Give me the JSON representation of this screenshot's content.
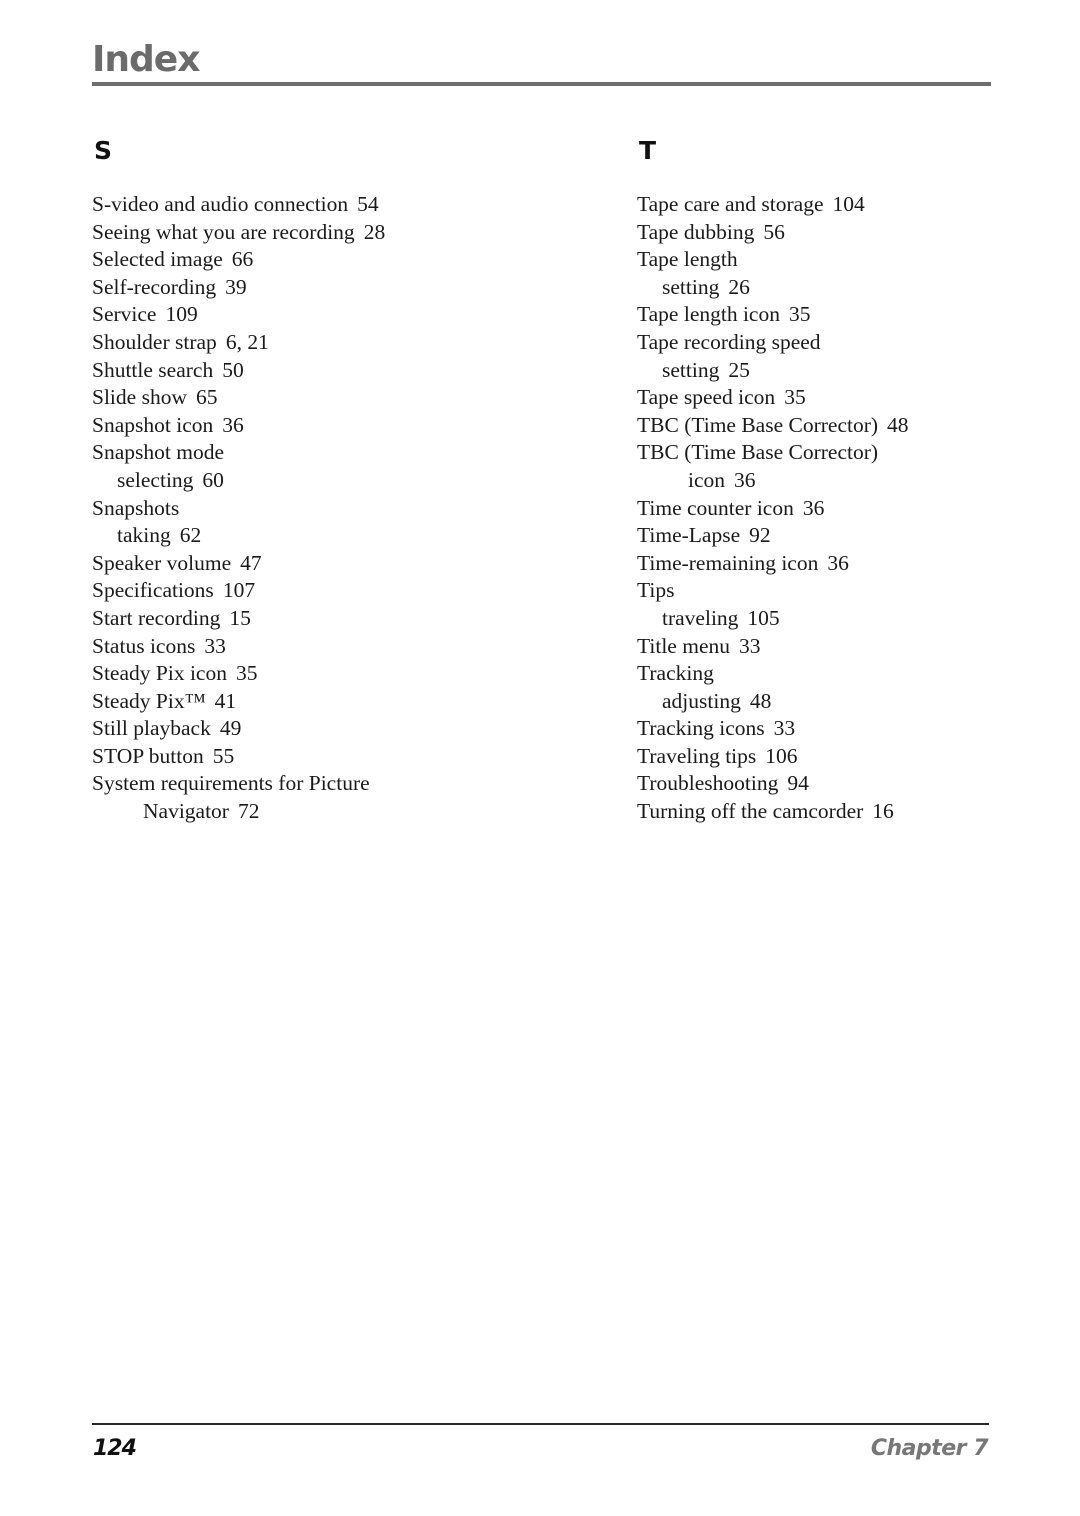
{
  "header": {
    "title": "Index"
  },
  "sections": [
    {
      "letter": "S",
      "entries": [
        {
          "term": "S-video and audio connection",
          "pages": "54",
          "level": 0
        },
        {
          "term": "Seeing what you are recording",
          "pages": "28",
          "level": 0
        },
        {
          "term": "Selected image",
          "pages": "66",
          "level": 0
        },
        {
          "term": "Self-recording",
          "pages": "39",
          "level": 0
        },
        {
          "term": "Service",
          "pages": "109",
          "level": 0
        },
        {
          "term": "Shoulder strap",
          "pages": "6,  21",
          "level": 0
        },
        {
          "term": "Shuttle search",
          "pages": "50",
          "level": 0
        },
        {
          "term": "Slide show",
          "pages": "65",
          "level": 0
        },
        {
          "term": "Snapshot icon",
          "pages": "36",
          "level": 0
        },
        {
          "term": "Snapshot mode",
          "pages": "",
          "level": 0
        },
        {
          "term": "selecting",
          "pages": "60",
          "level": 1
        },
        {
          "term": "Snapshots",
          "pages": "",
          "level": 0
        },
        {
          "term": "taking",
          "pages": "62",
          "level": 1
        },
        {
          "term": "Speaker volume",
          "pages": "47",
          "level": 0
        },
        {
          "term": "Specifications",
          "pages": "107",
          "level": 0
        },
        {
          "term": "Start recording",
          "pages": "15",
          "level": 0
        },
        {
          "term": "Status icons",
          "pages": "33",
          "level": 0
        },
        {
          "term": "Steady Pix icon",
          "pages": "35",
          "level": 0
        },
        {
          "term": "Steady Pix™",
          "pages": "41",
          "level": 0
        },
        {
          "term": "Still playback",
          "pages": "49",
          "level": 0
        },
        {
          "term": "STOP button",
          "pages": "55",
          "level": 0
        },
        {
          "term": "System requirements for Picture",
          "pages": "",
          "level": 0
        },
        {
          "term": "Navigator",
          "pages": "72",
          "level": 2
        }
      ]
    },
    {
      "letter": "T",
      "entries": [
        {
          "term": "Tape care and storage",
          "pages": "104",
          "level": 0
        },
        {
          "term": "Tape dubbing",
          "pages": "56",
          "level": 0
        },
        {
          "term": "Tape length",
          "pages": "",
          "level": 0
        },
        {
          "term": "setting",
          "pages": "26",
          "level": 1
        },
        {
          "term": "Tape length icon",
          "pages": "35",
          "level": 0
        },
        {
          "term": "Tape recording speed",
          "pages": "",
          "level": 0
        },
        {
          "term": "setting",
          "pages": "25",
          "level": 1
        },
        {
          "term": "Tape speed icon",
          "pages": "35",
          "level": 0
        },
        {
          "term": "TBC (Time Base Corrector)",
          "pages": "48",
          "level": 0
        },
        {
          "term": "TBC (Time Base Corrector)",
          "pages": "",
          "level": 0
        },
        {
          "term": "icon",
          "pages": "36",
          "level": 2
        },
        {
          "term": "Time counter icon",
          "pages": "36",
          "level": 0
        },
        {
          "term": "Time-Lapse",
          "pages": "92",
          "level": 0
        },
        {
          "term": "Time-remaining icon",
          "pages": "36",
          "level": 0
        },
        {
          "term": "Tips",
          "pages": "",
          "level": 0
        },
        {
          "term": "traveling",
          "pages": "105",
          "level": 1
        },
        {
          "term": "Title menu",
          "pages": "33",
          "level": 0
        },
        {
          "term": "Tracking",
          "pages": "",
          "level": 0
        },
        {
          "term": "adjusting",
          "pages": "48",
          "level": 1
        },
        {
          "term": "Tracking icons",
          "pages": "33",
          "level": 0
        },
        {
          "term": "Traveling tips",
          "pages": "106",
          "level": 0
        },
        {
          "term": "Troubleshooting",
          "pages": "94",
          "level": 0
        },
        {
          "term": "Turning off the camcorder",
          "pages": "16",
          "level": 0
        }
      ]
    }
  ],
  "footer": {
    "page_number": "124",
    "chapter": "Chapter 7"
  },
  "colors": {
    "title": "#6b6b6b",
    "header_rule": "#6e6e6e",
    "text": "#1a1a1a",
    "chapter_label": "#777777"
  }
}
